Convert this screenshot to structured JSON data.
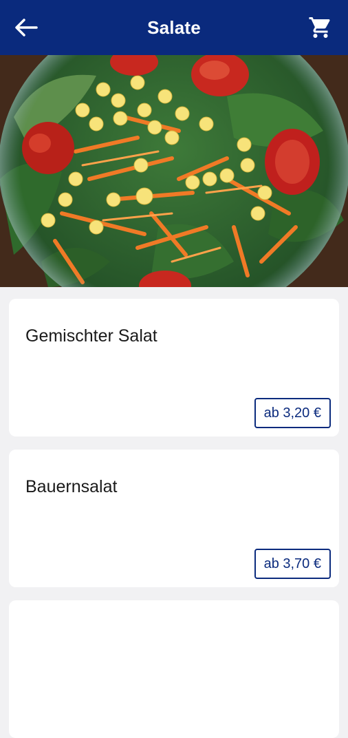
{
  "header": {
    "title": "Salate",
    "back_icon": "arrow-left-icon",
    "cart_icon": "shopping-cart-icon",
    "background_color": "#0a2a7d"
  },
  "hero": {
    "image": "salad-bowl-photo"
  },
  "products": [
    {
      "name": "Gemischter Salat",
      "price": "ab 3,20 €"
    },
    {
      "name": "Bauernsalat",
      "price": "ab 3,70 €"
    }
  ],
  "colors": {
    "accent": "#0a2a7d",
    "background": "#f1f1f3",
    "card": "#ffffff"
  }
}
